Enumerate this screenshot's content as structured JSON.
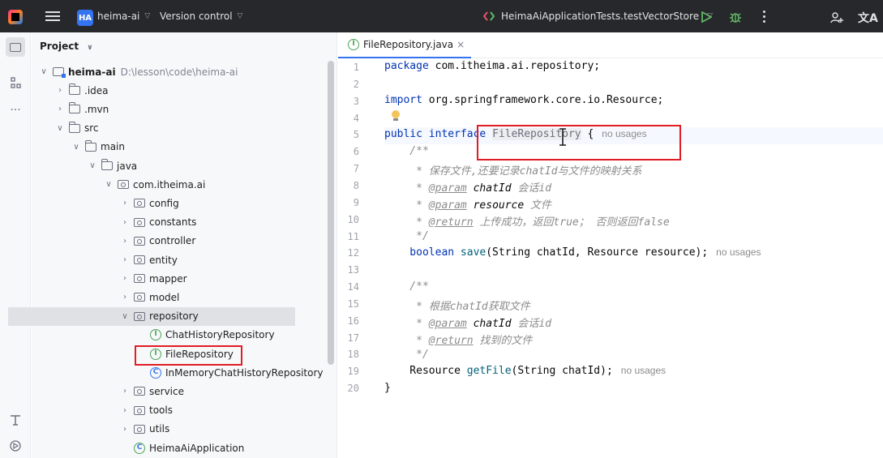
{
  "titlebar": {
    "project_badge": "HA",
    "project_name": "heima-ai",
    "vcs_label": "Version control",
    "run_config": "HeimaAiApplicationTests.testVectorStore",
    "icons": [
      "app-logo-icon",
      "hamburger-menu-icon",
      "run-config-icon",
      "run-icon",
      "debug-icon",
      "more-vertical-icon",
      "add-user-icon",
      "translate-icon"
    ]
  },
  "toolstrip": {
    "icons": [
      "project-folder-icon",
      "structure-icon",
      "more-horizontal-icon",
      "services-icon",
      "run-tool-icon"
    ]
  },
  "project_panel": {
    "title": "Project",
    "tree": [
      {
        "label": "heima-ai",
        "extra": "D:\\lesson\\code\\heima-ai",
        "icon": "module-folder-icon",
        "arrow": "down"
      },
      {
        "label": ".idea",
        "icon": "folder-icon",
        "arrow": "right"
      },
      {
        "label": ".mvn",
        "icon": "folder-icon",
        "arrow": "right"
      },
      {
        "label": "src",
        "icon": "folder-icon",
        "arrow": "down"
      },
      {
        "label": "main",
        "icon": "folder-icon",
        "arrow": "down"
      },
      {
        "label": "java",
        "icon": "folder-icon",
        "arrow": "down"
      },
      {
        "label": "com.itheima.ai",
        "icon": "package-icon",
        "arrow": "down"
      },
      {
        "label": "config",
        "icon": "package-icon",
        "arrow": "right"
      },
      {
        "label": "constants",
        "icon": "package-icon",
        "arrow": "right"
      },
      {
        "label": "controller",
        "icon": "package-icon",
        "arrow": "right"
      },
      {
        "label": "entity",
        "icon": "package-icon",
        "arrow": "right"
      },
      {
        "label": "mapper",
        "icon": "package-icon",
        "arrow": "right"
      },
      {
        "label": "model",
        "icon": "package-icon",
        "arrow": "right"
      },
      {
        "label": "repository",
        "icon": "package-icon",
        "arrow": "down"
      },
      {
        "label": "ChatHistoryRepository",
        "icon": "interface-icon",
        "arrow": ""
      },
      {
        "label": "FileRepository",
        "icon": "interface-icon",
        "arrow": ""
      },
      {
        "label": "InMemoryChatHistoryRepository",
        "icon": "class-icon",
        "arrow": ""
      },
      {
        "label": "service",
        "icon": "package-icon",
        "arrow": "right"
      },
      {
        "label": "tools",
        "icon": "package-icon",
        "arrow": "right"
      },
      {
        "label": "utils",
        "icon": "package-icon",
        "arrow": "right"
      },
      {
        "label": "HeimaAiApplication",
        "icon": "spring-app-icon",
        "arrow": ""
      }
    ]
  },
  "editor": {
    "tab_label": "FileRepository.java",
    "tab_close": "×",
    "line_numbers": [
      "1",
      "2",
      "3",
      "4",
      "5",
      "6",
      "7",
      "8",
      "9",
      "10",
      "11",
      "12",
      "13",
      "14",
      "15",
      "16",
      "17",
      "18",
      "19",
      "20"
    ],
    "code": {
      "l1_kw": "package",
      "l1_rest": " com.itheima.ai.repository;",
      "l3_kw": "import",
      "l3_rest": " org.springframework.core.io.Resource;",
      "l5_kw": "public interface",
      "l5_name": "FileRepository",
      "l5_rest": " {",
      "l5_hint": "no usages",
      "l6": "    /**",
      "l7": "     * 保存文件,还要记录chatId与文件的映射关系",
      "l8_pre": "     * ",
      "l8_tag": "@param",
      "l8_name": " chatId",
      "l8_desc": " 会话id",
      "l9_pre": "     * ",
      "l9_tag": "@param",
      "l9_name": " resource",
      "l9_desc": " 文件",
      "l10_pre": "     * ",
      "l10_tag": "@return",
      "l10_desc": " 上传成功，返回true； 否则返回false",
      "l11": "     */",
      "l12_kw": "    boolean",
      "l12_fn": " save",
      "l12_rest": "(String chatId, Resource resource);",
      "l12_hint": "no usages",
      "l14": "    /**",
      "l15": "     * 根据chatId获取文件",
      "l16_pre": "     * ",
      "l16_tag": "@param",
      "l16_name": " chatId",
      "l16_desc": " 会话id",
      "l17_pre": "     * ",
      "l17_tag": "@return",
      "l17_desc": " 找到的文件",
      "l18": "     */",
      "l19_pre": "    Resource",
      "l19_fn": " getFile",
      "l19_rest": "(String chatId);",
      "l19_hint": "no usages",
      "l20": "}"
    }
  },
  "colors": {
    "titlebar_bg": "#27282c",
    "accent": "#3574f0",
    "keyword": "#0033b3",
    "comment": "#8c8c8c",
    "highlight_box": "#e01d24",
    "interface_green": "#4ea457"
  }
}
